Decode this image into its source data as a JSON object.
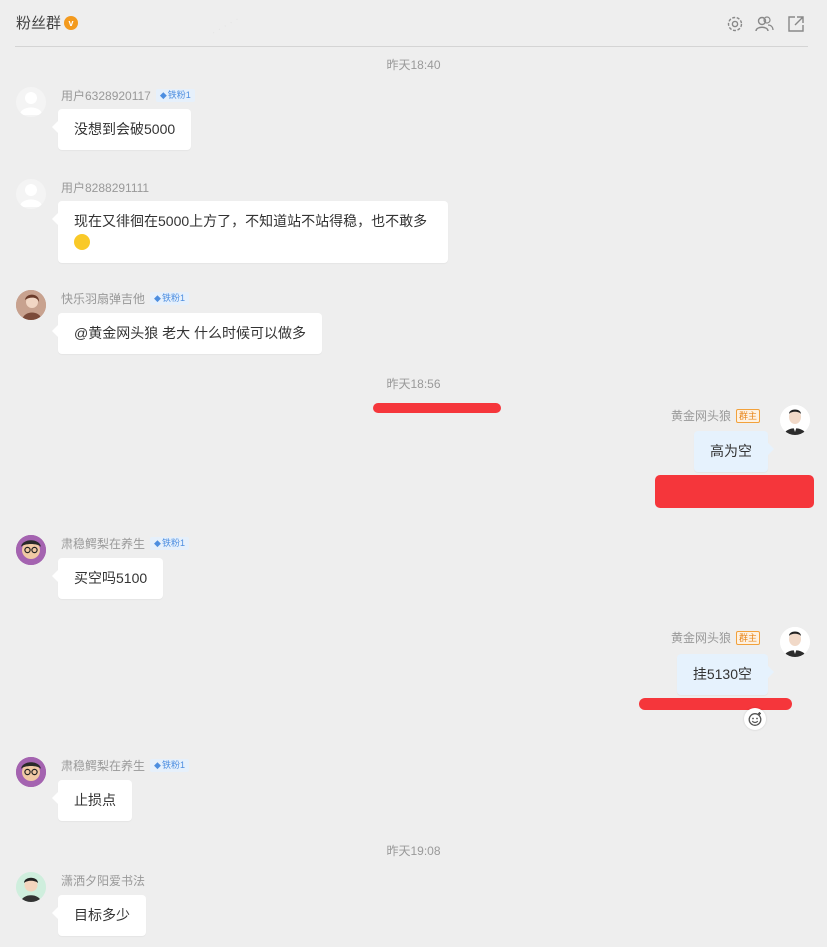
{
  "header": {
    "title": "粉丝群",
    "badge": "v",
    "icons": [
      "gear-icon",
      "members-icon",
      "popout-icon"
    ]
  },
  "times": [
    "昨天18:40",
    "昨天18:56",
    "昨天19:08"
  ],
  "messages": [
    {
      "user": "用户6328920117",
      "fan": "铁粉1",
      "text": "没想到会破5000"
    },
    {
      "user": "用户8288291111",
      "text": "现在又徘徊在5000上方了，不知道站不站得稳，也不敢多"
    },
    {
      "user": "快乐羽扇弹吉他",
      "fan": "铁粉1",
      "text": "@黄金网头狼 老大 什么时候可以做多"
    },
    {
      "user": "黄金网头狼",
      "role": "群主",
      "text": "高为空"
    },
    {
      "user": "肃稳鳄梨在养生",
      "fan": "铁粉1",
      "text": "买空吗5100"
    },
    {
      "user": "黄金网头狼",
      "role": "群主",
      "text": "挂5130空"
    },
    {
      "user": "肃稳鳄梨在养生",
      "fan": "铁粉1",
      "text": "止损点"
    },
    {
      "user": "潇洒夕阳爱书法",
      "text": "目标多少"
    }
  ],
  "colors": {
    "background": "#eeeeee",
    "bubble_self": "#e6f2fd",
    "red_annotation": "#f5363b",
    "badge_orange": "#f39a1e",
    "fan_blue": "#4d8ee0"
  }
}
